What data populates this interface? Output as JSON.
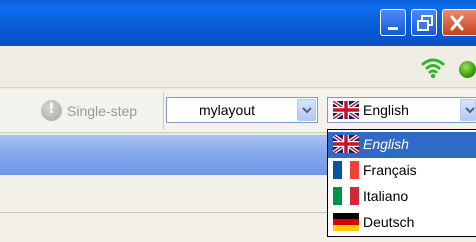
{
  "window": {
    "controls": [
      "minimize",
      "restore",
      "close"
    ]
  },
  "status": {
    "signal_icon": "wifi-signal-icon",
    "led_color": "#3da012"
  },
  "toolbar": {
    "single_step_label": "Single-step",
    "layout_value": "mylayout",
    "language_value": "English"
  },
  "language_dropdown": {
    "items": [
      {
        "label": "English",
        "flag": "uk",
        "selected": true
      },
      {
        "label": "Français",
        "flag": "france",
        "selected": false
      },
      {
        "label": "Italiano",
        "flag": "italy",
        "selected": false
      },
      {
        "label": "Deutsch",
        "flag": "germany",
        "selected": false
      }
    ],
    "highlight_color": "#316ac5"
  }
}
